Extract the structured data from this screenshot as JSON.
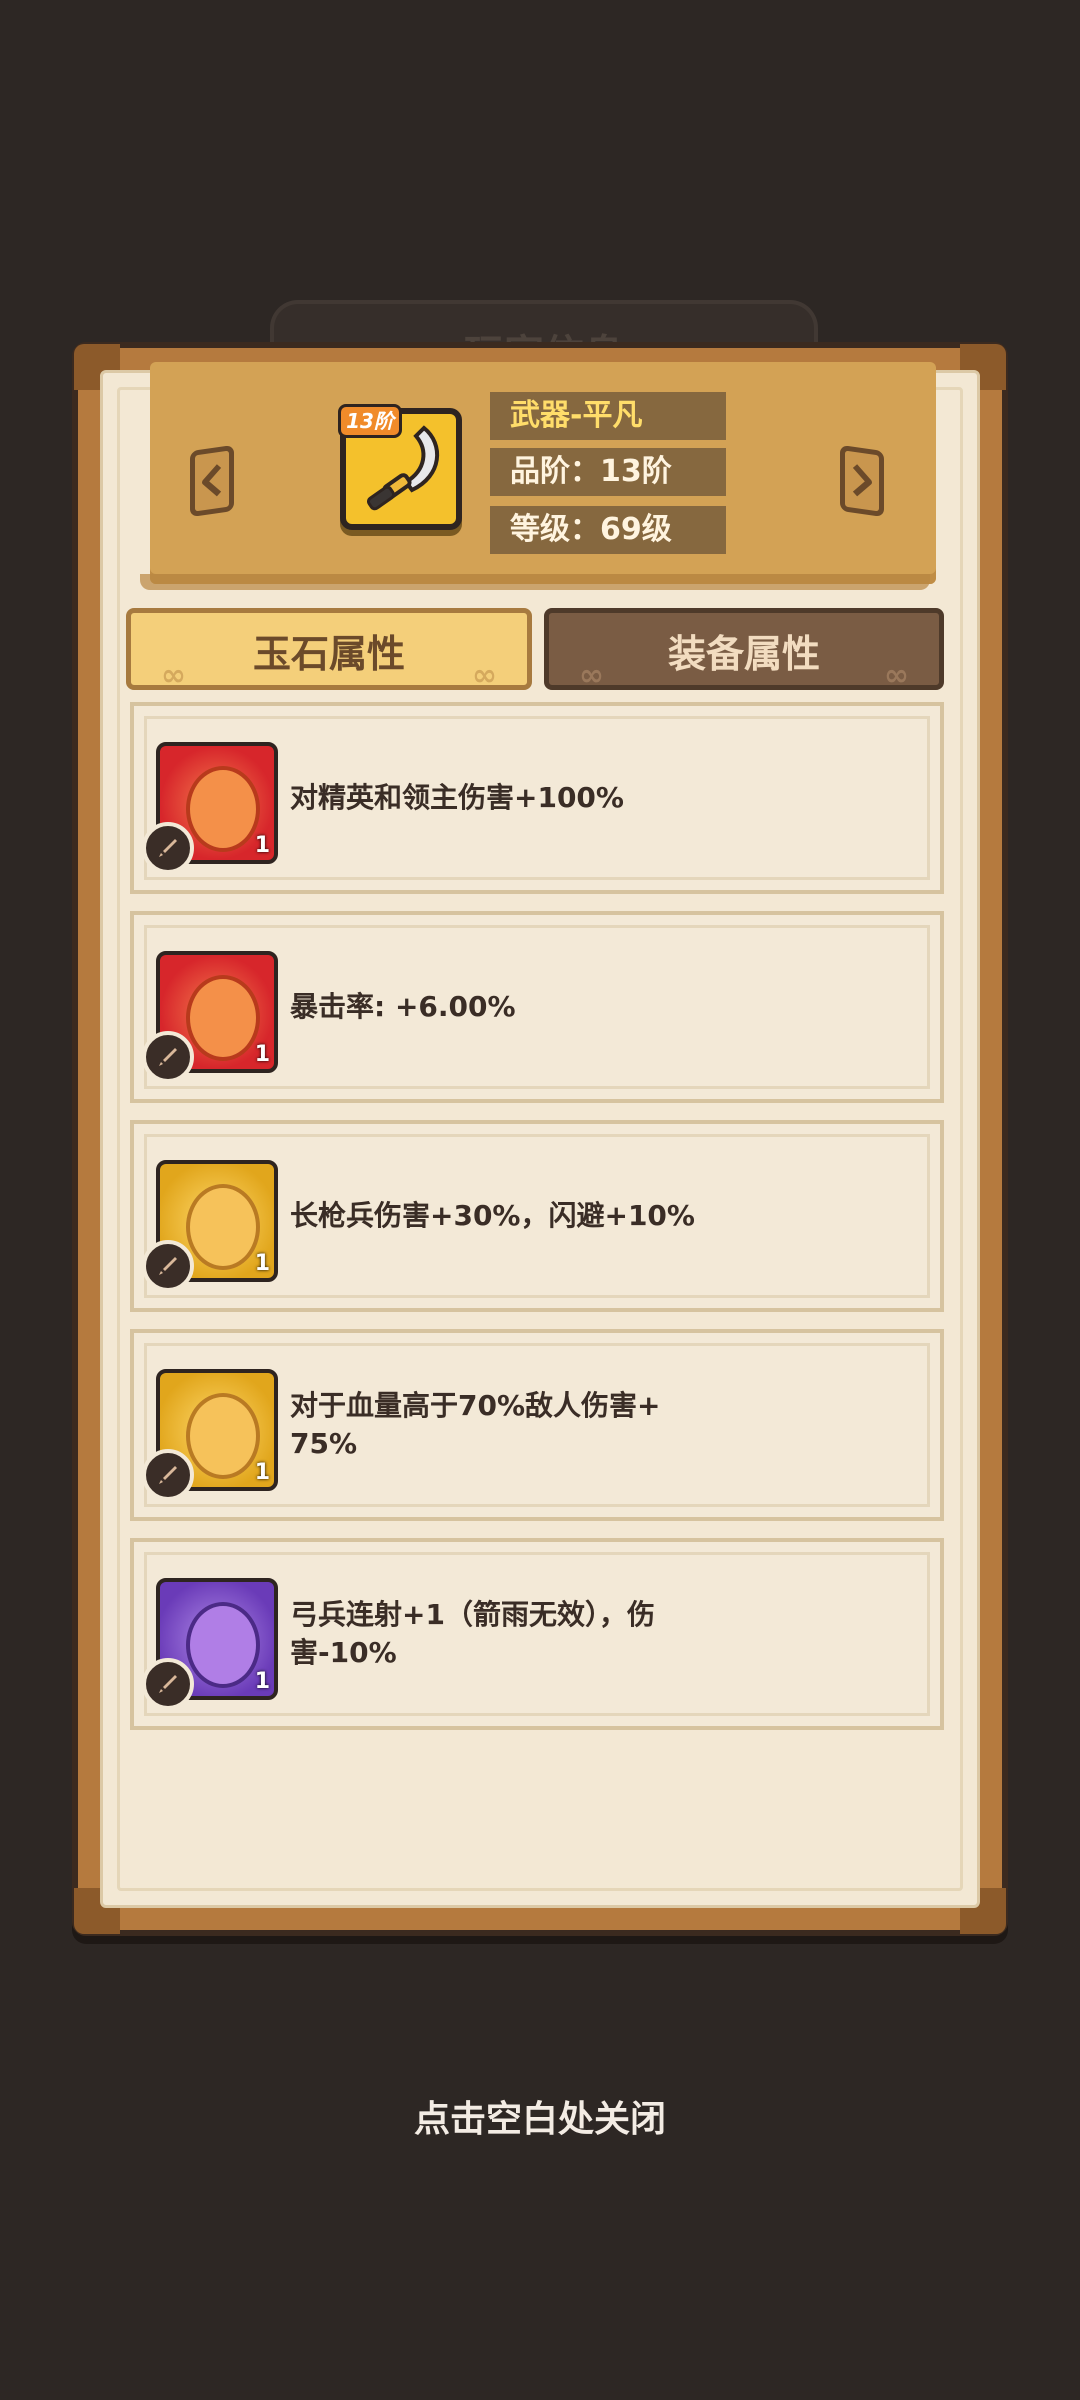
{
  "background_panel": {
    "title": "玩家信息"
  },
  "item": {
    "tier_tag": "13阶",
    "name": "武器-平凡",
    "quality": "品阶：13阶",
    "level": "等级：69级",
    "icon": "scimitar-icon"
  },
  "tabs": [
    {
      "label": "玉石属性",
      "active": true
    },
    {
      "label": "装备属性",
      "active": false
    }
  ],
  "properties": [
    {
      "gem_color": "red",
      "count": "1",
      "text": "对精英和领主伤害+100%"
    },
    {
      "gem_color": "red",
      "count": "1",
      "text": "暴击率: +6.00%"
    },
    {
      "gem_color": "gold",
      "count": "1",
      "text": "长枪兵伤害+30%，闪避+10%"
    },
    {
      "gem_color": "gold",
      "count": "1",
      "text": "对于血量高于70%敌人伤害+ 75%"
    },
    {
      "gem_color": "purple",
      "count": "1",
      "text": "弓兵连射+1（箭雨无效），伤害-10%"
    }
  ],
  "close_hint": "点击空白处关闭",
  "colors": {
    "background": "#2d2724",
    "frame": "#b57a3e",
    "paper": "#f3e8d4",
    "banner": "#d3a255",
    "active_tab": "#f4cf7a",
    "inactive_tab": "#7a5c44"
  }
}
